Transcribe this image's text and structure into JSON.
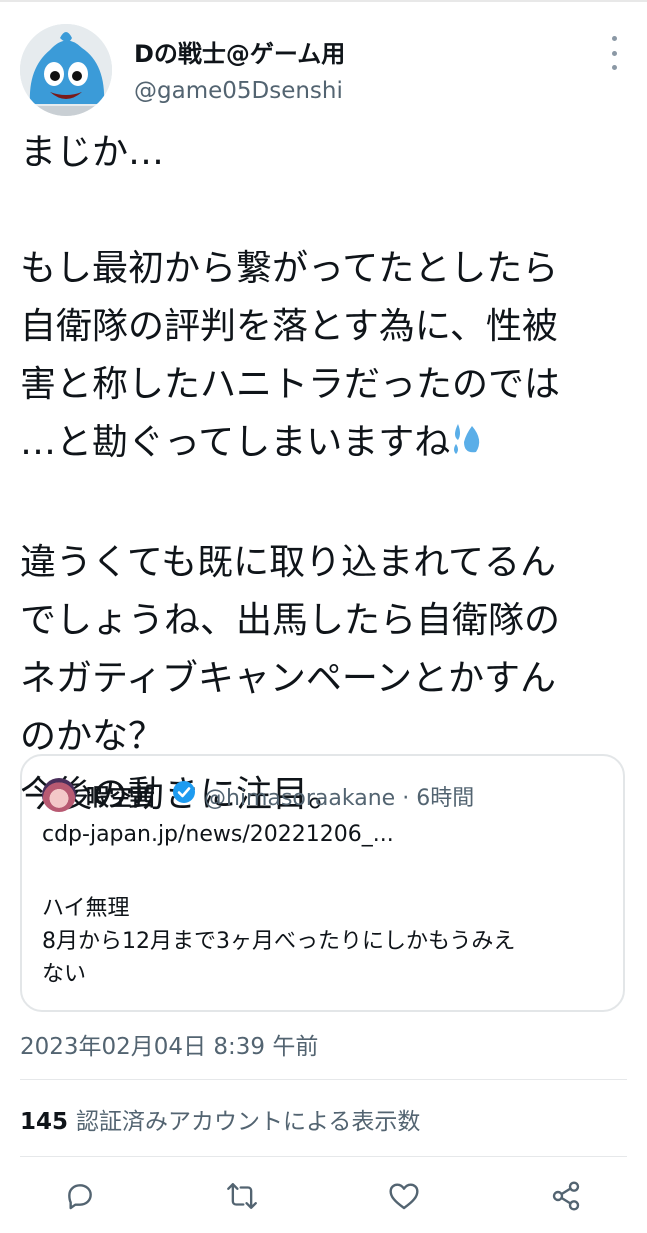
{
  "tweet": {
    "display_name": "Dの戦士@ゲーム用",
    "handle": "@game05Dsenshi",
    "text": "まじか…\n\nもし最初から繋がってたとしたら\n自衛隊の評判を落とす為に、性被\n害と称したハニトラだったのでは\n…と勘ぐってしまいますね",
    "text2": "\n\n違うくても既に取り込まれてるん\nでしょうね、出馬したら自衛隊の\nネガティブキャンペーンとかすん\nのかな？\n今後の動きに注目。",
    "emoji": "sweat-droplets",
    "timestamp": "2023年02月04日 8:39 午前"
  },
  "quote": {
    "display_name": "暇空茜",
    "handle_time": "@himasoraakane · 6時間",
    "link": "cdp-japan.jp/news/20221206_...",
    "text": "ハイ無理\n8月から12月まで3ヶ月べったりにしかもうみえ\nない"
  },
  "views": {
    "count": "145",
    "label": "認証済みアカウントによる表示数"
  },
  "actions": [
    "reply-icon",
    "retweet-icon",
    "like-icon",
    "share-icon"
  ]
}
